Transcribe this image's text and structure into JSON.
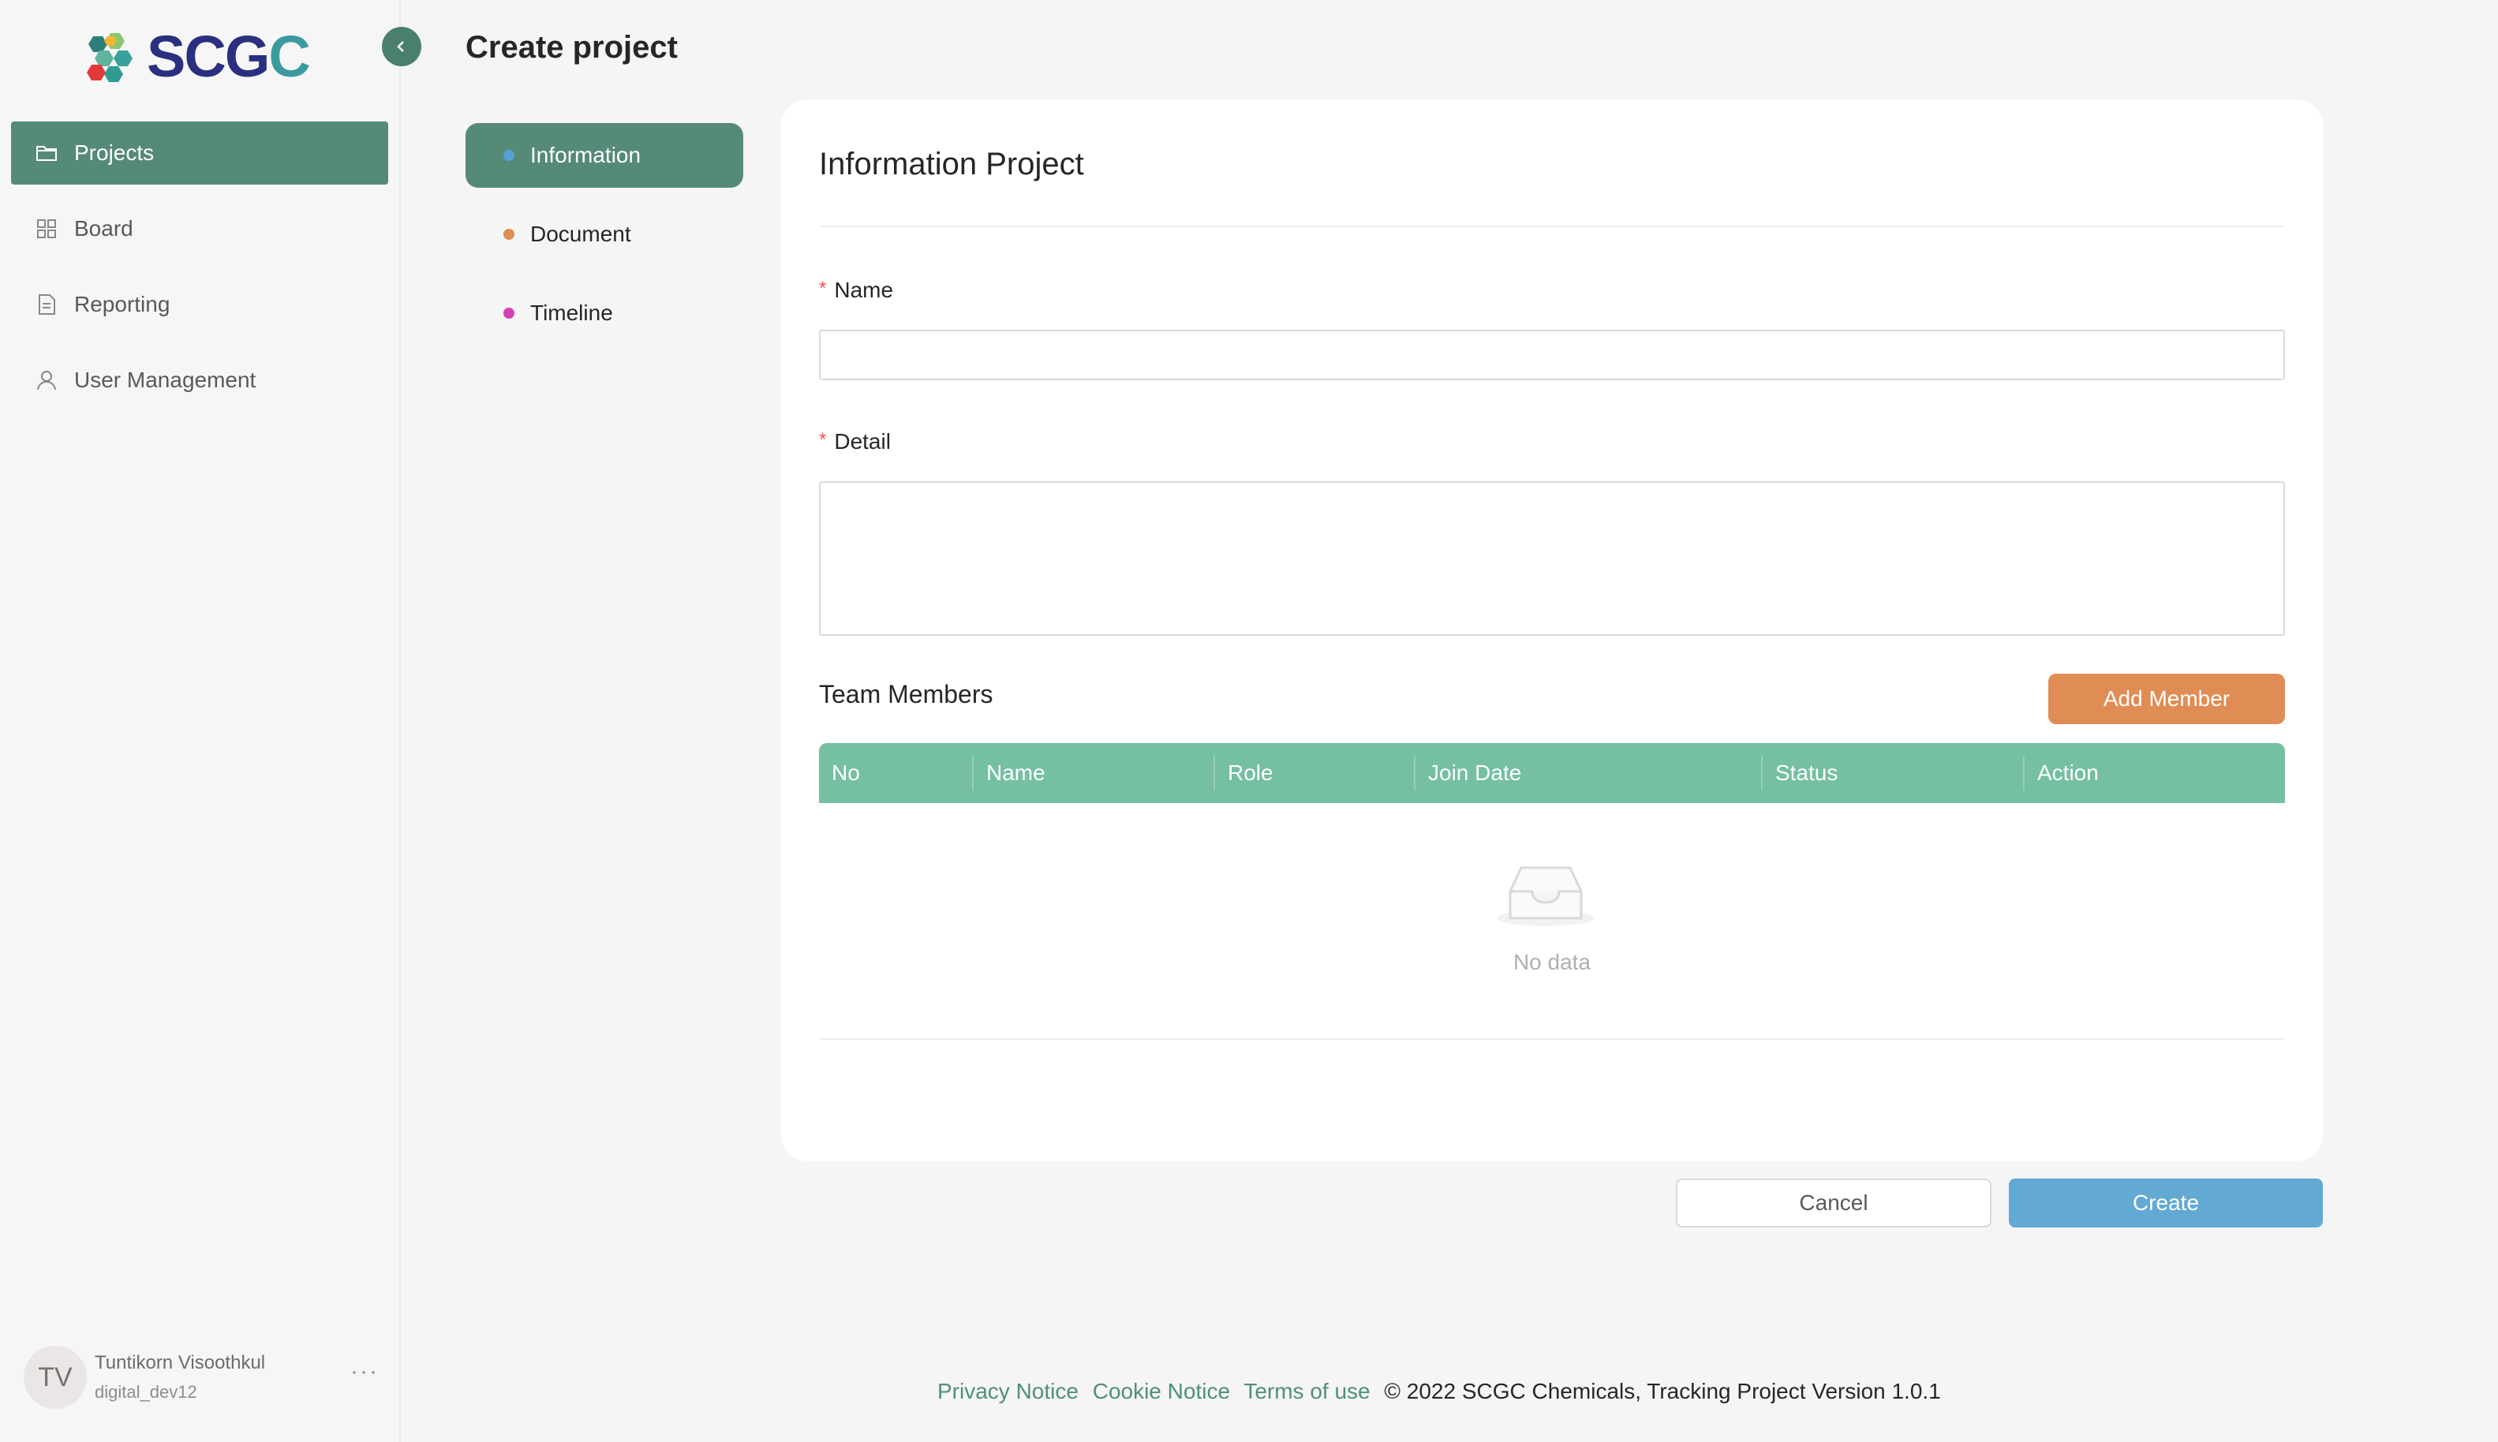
{
  "app": {
    "logo_text_a": "SC",
    "logo_text_b": "G",
    "logo_text_c": "C"
  },
  "sidebar": {
    "items": [
      {
        "label": "Projects",
        "icon": "folder-icon",
        "active": true
      },
      {
        "label": "Board",
        "icon": "grid-icon",
        "active": false
      },
      {
        "label": "Reporting",
        "icon": "document-icon",
        "active": false
      },
      {
        "label": "User Management",
        "icon": "user-icon",
        "active": false
      }
    ],
    "user": {
      "initials": "TV",
      "name": "Tuntikorn Visoothkul",
      "username": "digital_dev12",
      "more": "···"
    }
  },
  "header": {
    "title": "Create project"
  },
  "steps": [
    {
      "label": "Information",
      "dot_color": "#5aa0d8",
      "active": true
    },
    {
      "label": "Document",
      "dot_color": "#df8d54",
      "active": false
    },
    {
      "label": "Timeline",
      "dot_color": "#d63fb5",
      "active": false
    }
  ],
  "form": {
    "title": "Information Project",
    "required_mark": "*",
    "name_label": "Name",
    "name_value": "",
    "detail_label": "Detail",
    "detail_value": "",
    "team_title": "Team Members",
    "add_member_label": "Add Member",
    "table_columns": [
      "No",
      "Name",
      "Role",
      "Join Date",
      "Status",
      "Action"
    ],
    "empty_text": "No data",
    "cancel_label": "Cancel",
    "create_label": "Create"
  },
  "footer": {
    "links": [
      "Privacy Notice",
      "Cookie Notice",
      "Terms of use"
    ],
    "copyright": "© 2022 SCGC Chemicals, Tracking Project Version 1.0.1"
  },
  "colors": {
    "accent": "#558a78",
    "table_header": "#75bfa3",
    "add_member": "#df8d54",
    "create": "#62a9d3"
  }
}
